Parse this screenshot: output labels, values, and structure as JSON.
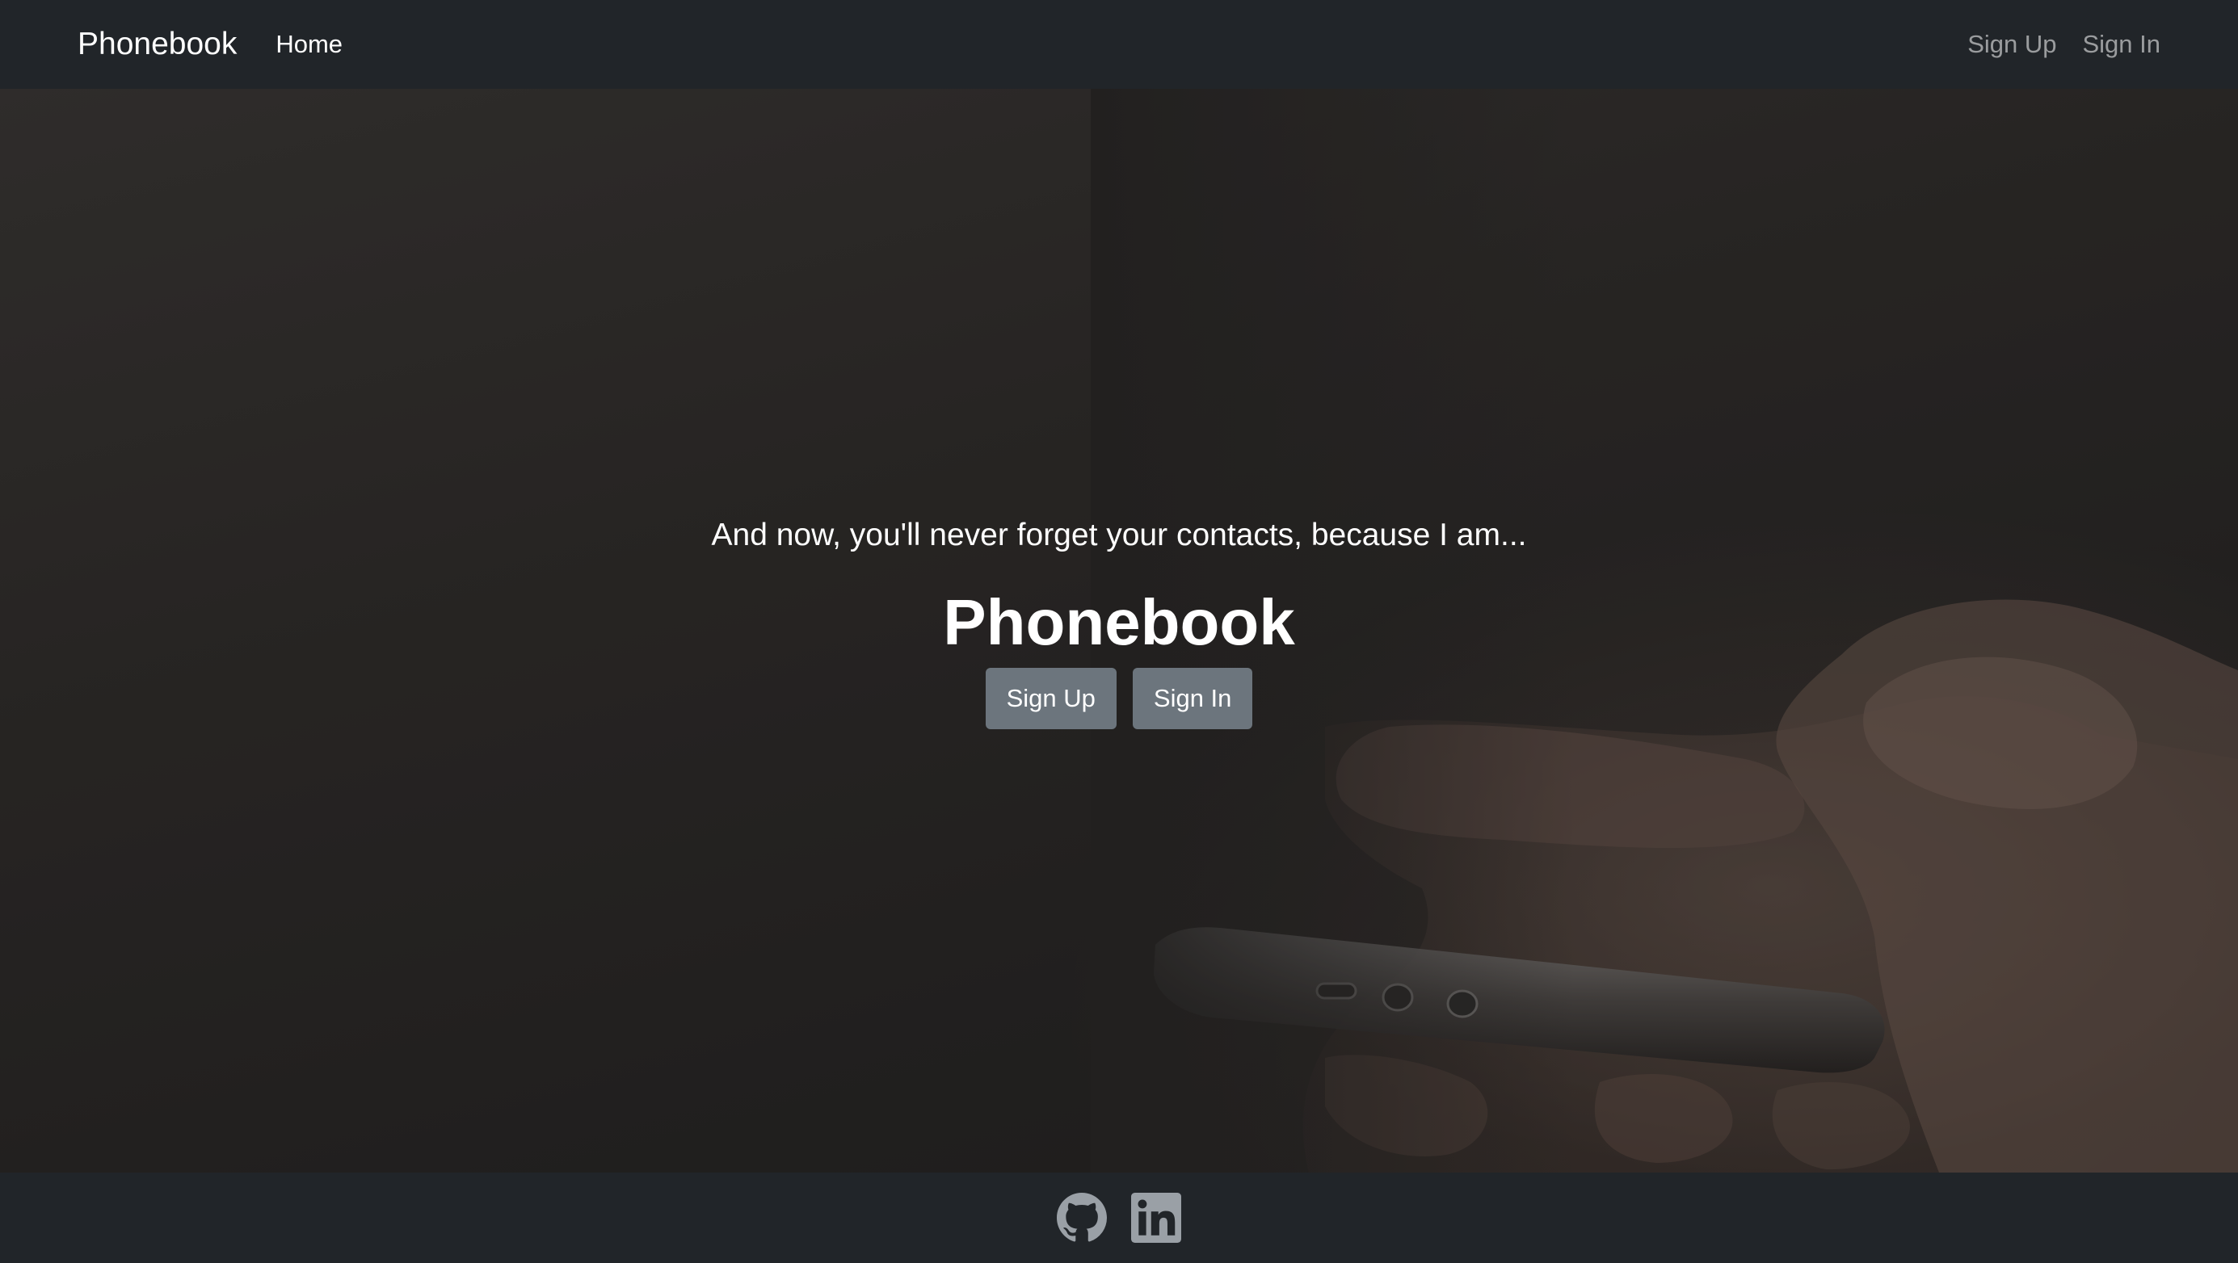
{
  "navbar": {
    "brand": "Phonebook",
    "home_label": "Home",
    "signup_label": "Sign Up",
    "signin_label": "Sign In"
  },
  "hero": {
    "tagline": "And now, you'll never forget your contacts, because I am...",
    "title": "Phonebook",
    "signup_button": "Sign Up",
    "signin_button": "Sign In"
  },
  "footer": {
    "icons": [
      "github-icon",
      "linkedin-icon"
    ]
  },
  "colors": {
    "navbar_bg": "#212529",
    "button_bg": "#6c757d",
    "nav_link_muted": "rgba(255,255,255,0.55)",
    "footer_icon": "#9aa0a6"
  }
}
